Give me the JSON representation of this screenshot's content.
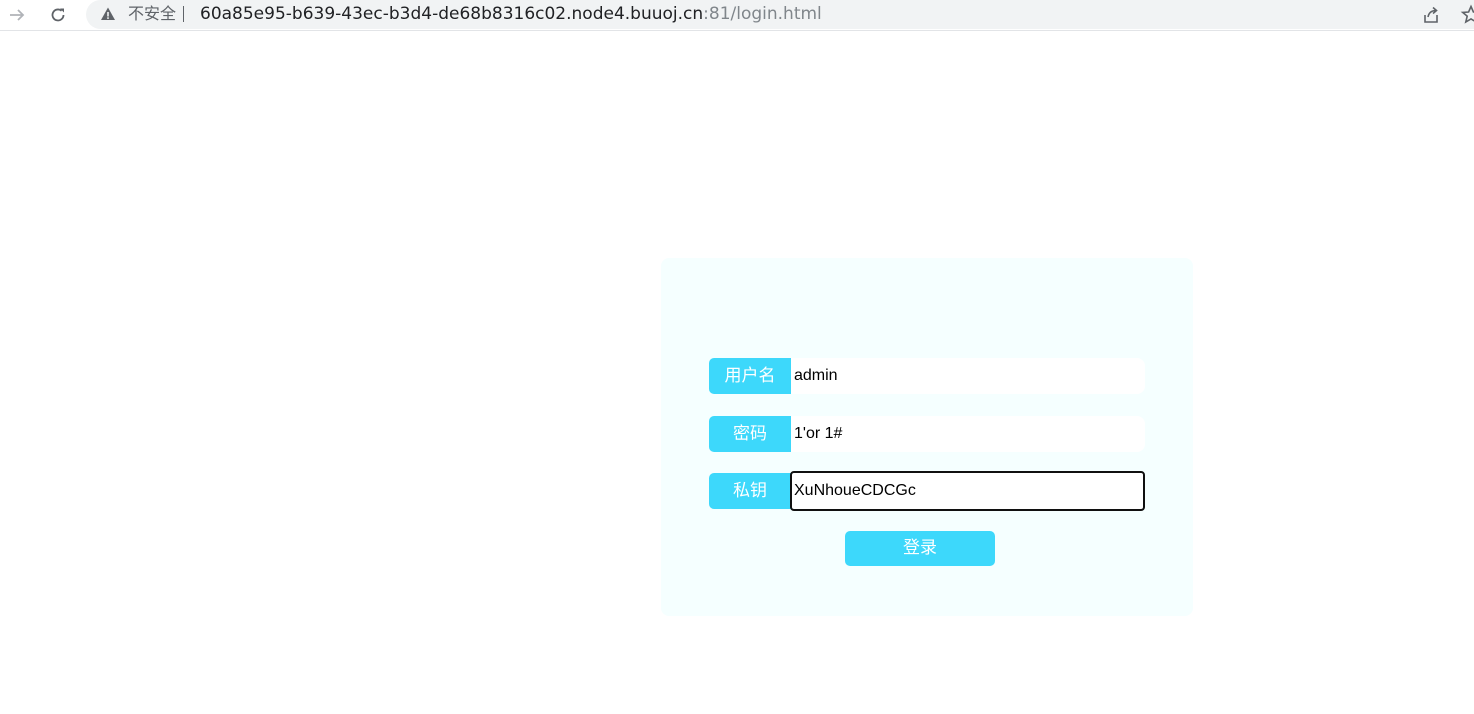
{
  "browser": {
    "security_label": "不安全",
    "url_host": "60a85e95-b639-43ec-b3d4-de68b8316c02.node4.buuoj.cn",
    "url_port": ":81",
    "url_path": "/login.html"
  },
  "login": {
    "username_label": "用户名",
    "username_value": "admin",
    "password_label": "密码",
    "password_value": "1'or 1#",
    "key_label": "私钥",
    "key_value": "XuNhoueCDCGc",
    "submit_label": "登录"
  },
  "colors": {
    "accent": "#3dd8fb",
    "panel_bg": "#f5ffff"
  }
}
